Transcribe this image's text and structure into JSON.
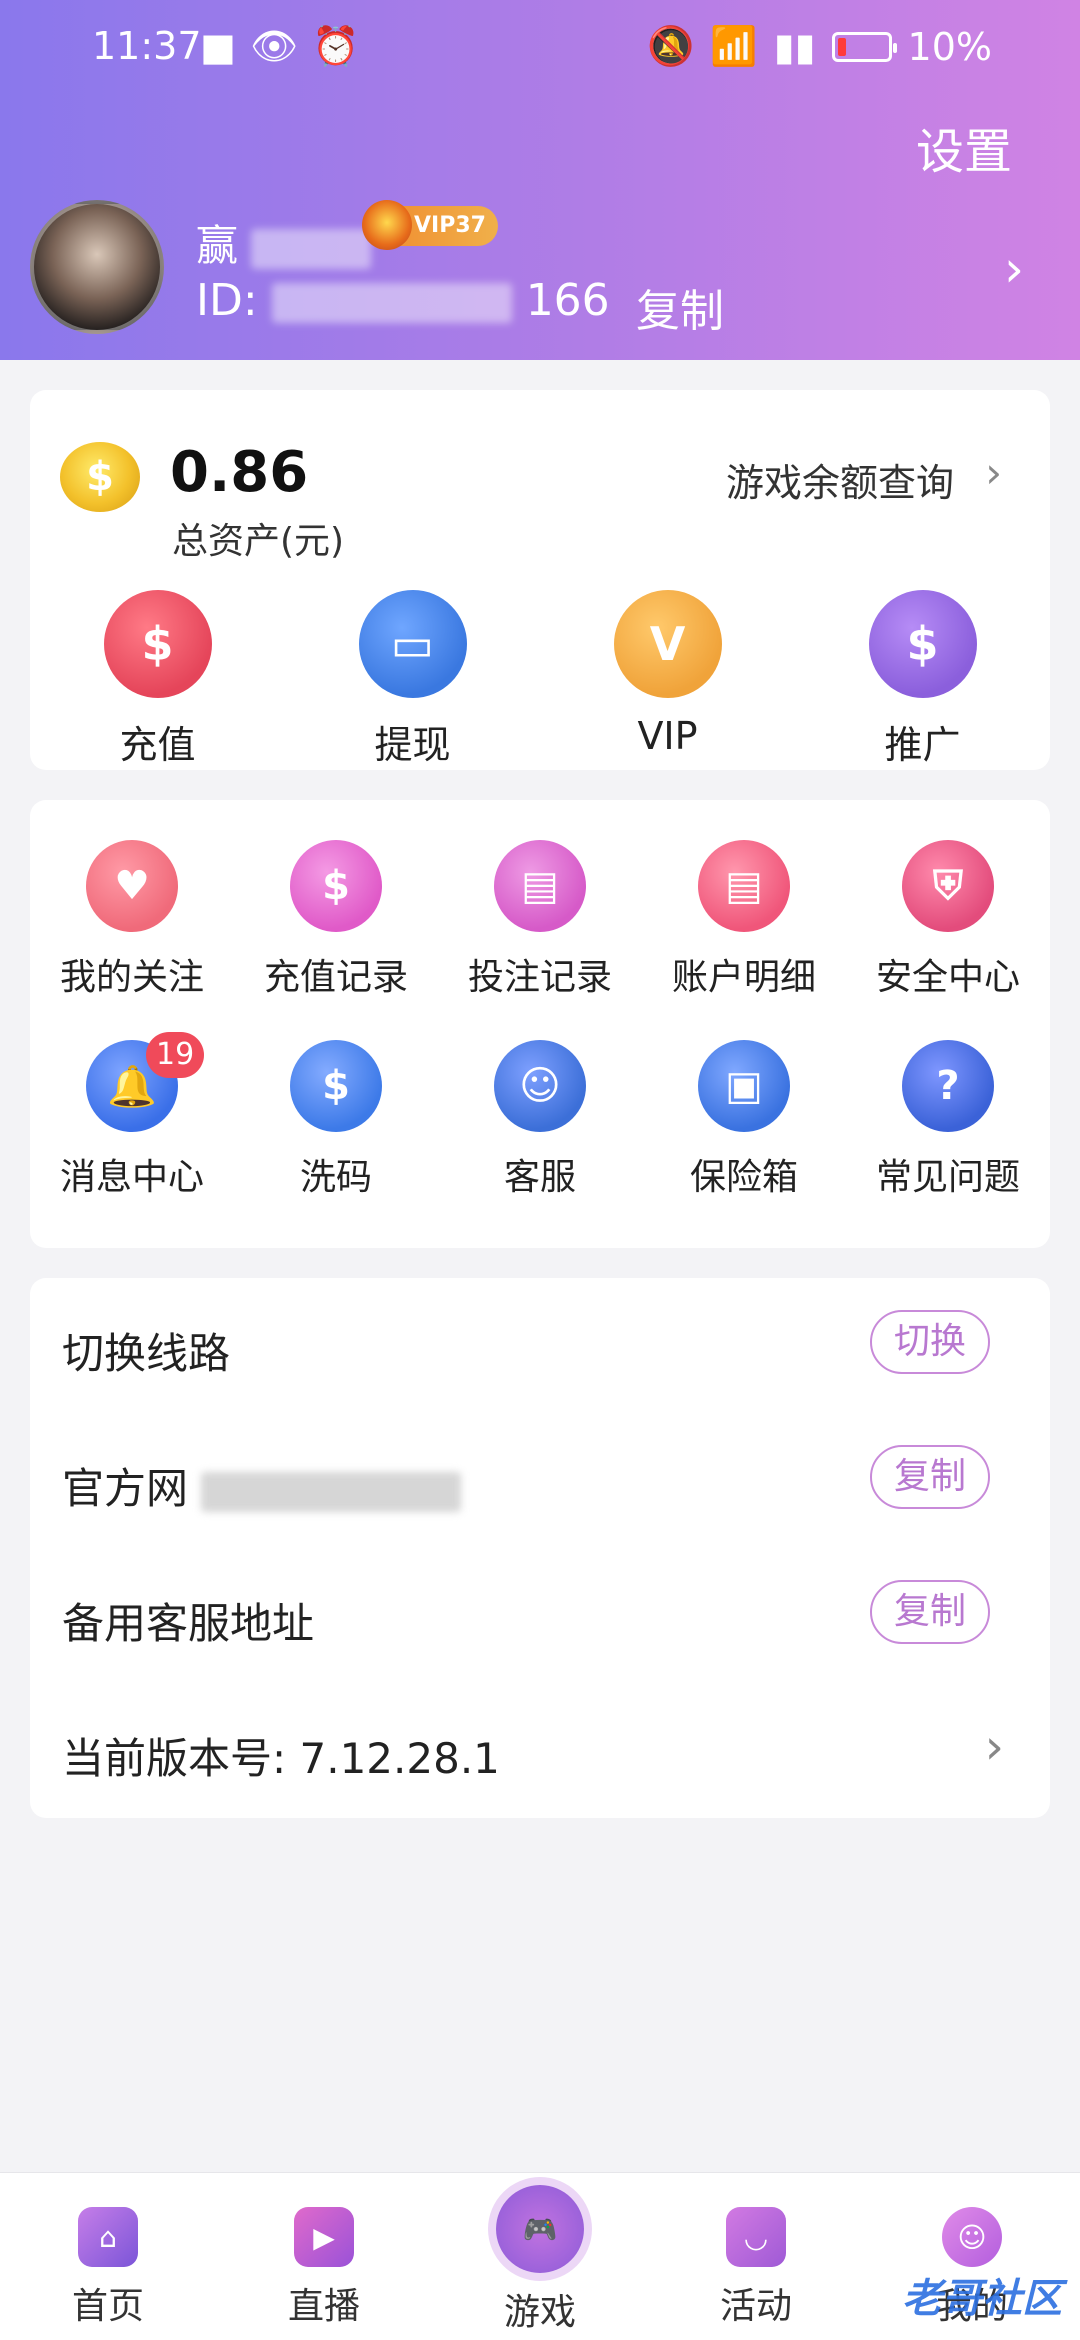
{
  "status_bar": {
    "time": "11:37",
    "battery": "10%"
  },
  "header": {
    "settings_label": "设置",
    "username": "赢",
    "vip_level": "VIP37",
    "id_prefix": "ID:",
    "id_suffix": "166",
    "copy_label": "复制"
  },
  "assets": {
    "balance": "0.86",
    "balance_label": "总资产(元)",
    "game_balance_label": "游戏余额查询",
    "quick_actions": [
      {
        "label": "充值",
        "icon": "money-bag-icon",
        "color": "#e5455a"
      },
      {
        "label": "提现",
        "icon": "card-icon",
        "color": "#3a78e0"
      },
      {
        "label": "VIP",
        "icon": "vip-diamond-icon",
        "color": "#f0a33a"
      },
      {
        "label": "推广",
        "icon": "money-sparkle-icon",
        "color": "#8b5fdc"
      }
    ]
  },
  "menu": {
    "items": [
      {
        "label": "我的关注",
        "icon": "heart-plus-icon",
        "color": "#f06a7a"
      },
      {
        "label": "充值记录",
        "icon": "receipt-dollar-icon",
        "color": "#e05ac8"
      },
      {
        "label": "投注记录",
        "icon": "document-dice-icon",
        "color": "#d65ac8"
      },
      {
        "label": "账户明细",
        "icon": "document-icon",
        "color": "#f0567a"
      },
      {
        "label": "安全中心",
        "icon": "shield-bag-icon",
        "color": "#e34c7c"
      },
      {
        "label": "消息中心",
        "icon": "bell-icon",
        "color": "#3a6fe8",
        "badge": "19"
      },
      {
        "label": "洗码",
        "icon": "chip-dollar-icon",
        "color": "#3d7ae8"
      },
      {
        "label": "客服",
        "icon": "headset-icon",
        "color": "#3c6fd8"
      },
      {
        "label": "保险箱",
        "icon": "safe-icon",
        "color": "#3a72e0"
      },
      {
        "label": "常见问题",
        "icon": "question-icon",
        "color": "#3b62d8"
      }
    ]
  },
  "settings": {
    "switch_route_label": "切换线路",
    "switch_button": "切换",
    "official_site_label": "官方网",
    "copy_button": "复制",
    "backup_cs_label": "备用客服地址",
    "version_label": "当前版本号:",
    "version_value": "7.12.28.1"
  },
  "tabbar": {
    "tabs": [
      {
        "label": "首页",
        "icon": "home-icon",
        "color": "#8e5ad6"
      },
      {
        "label": "直播",
        "icon": "video-icon",
        "color": "#c05ad8"
      },
      {
        "label": "游戏",
        "icon": "gamepad-icon",
        "color": "#a45ed8",
        "active": true
      },
      {
        "label": "活动",
        "icon": "gift-icon",
        "color": "#b05ad6"
      },
      {
        "label": "我的",
        "icon": "smile-icon",
        "color": "#c066e0"
      }
    ]
  },
  "watermark": "老哥社区"
}
